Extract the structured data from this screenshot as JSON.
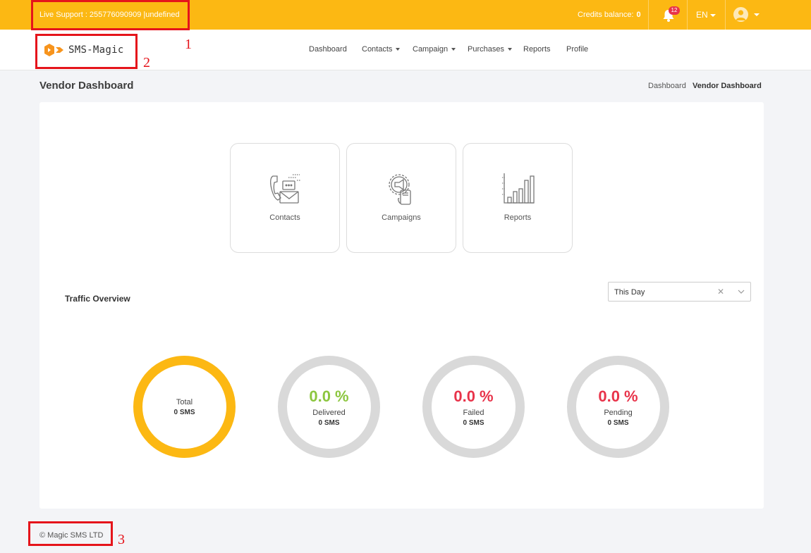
{
  "topbar": {
    "live_support": "Live Support  : 255776090909 |undefined",
    "credits_label": "Credits balance:",
    "credits_value": "0",
    "notifications_count": "12",
    "language": "EN",
    "icons": [
      "bell-icon",
      "user-avatar-icon"
    ],
    "background_color": "#fcb813"
  },
  "brand": {
    "name": "SMS-Magic",
    "logo_color": "#f7941d"
  },
  "nav": {
    "items": [
      {
        "label": "Dashboard",
        "has_dropdown": false
      },
      {
        "label": "Contacts",
        "has_dropdown": true
      },
      {
        "label": "Campaign",
        "has_dropdown": true
      },
      {
        "label": "Purchases",
        "has_dropdown": true
      },
      {
        "label": "Reports",
        "has_dropdown": false
      },
      {
        "label": "Profile",
        "has_dropdown": false
      }
    ]
  },
  "page": {
    "title": "Vendor Dashboard",
    "breadcrumb": [
      "Dashboard",
      "Vendor Dashboard"
    ]
  },
  "quick_links": [
    {
      "label": "Contacts",
      "icon": "contacts-icon"
    },
    {
      "label": "Campaigns",
      "icon": "campaigns-icon"
    },
    {
      "label": "Reports",
      "icon": "reports-icon"
    }
  ],
  "traffic": {
    "title": "Traffic Overview",
    "period": "This Day",
    "stats": [
      {
        "label": "Total",
        "percent": "",
        "count": "0 SMS",
        "color": "#fcb813"
      },
      {
        "label": "Delivered",
        "percent": "0.0 %",
        "count": "0 SMS",
        "color": "#8cc63f"
      },
      {
        "label": "Failed",
        "percent": "0.0 %",
        "count": "0 SMS",
        "color": "#e8334a"
      },
      {
        "label": "Pending",
        "percent": "0.0 %",
        "count": "0 SMS",
        "color": "#e8334a"
      }
    ]
  },
  "footer": {
    "copyright": "© Magic SMS LTD"
  },
  "annotations": [
    "1",
    "2",
    "3"
  ]
}
